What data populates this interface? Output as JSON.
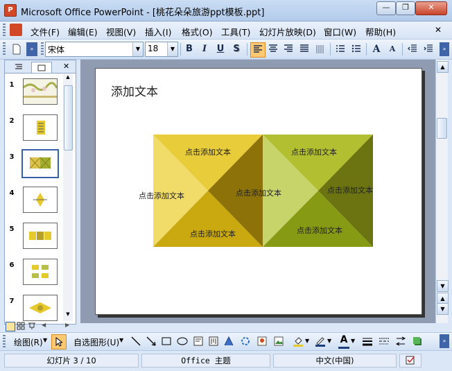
{
  "window": {
    "title": "Microsoft Office PowerPoint - [桃花朵朵旅游ppt模板.ppt]",
    "app_icon": "powerpoint-icon",
    "minimize_label": "—",
    "restore_label": "❐",
    "close_label": "✕"
  },
  "menu": {
    "items": [
      "文件(F)",
      "编辑(E)",
      "视图(V)",
      "插入(I)",
      "格式(O)",
      "工具(T)",
      "幻灯片放映(D)",
      "窗口(W)",
      "帮助(H)"
    ],
    "close_doc": "✕"
  },
  "toolbar": {
    "font_name": "宋体",
    "font_size": "18",
    "bold": "B",
    "italic": "I",
    "underline": "U",
    "shadow": "S",
    "grow_font": "A",
    "shrink_font": "A"
  },
  "left_pane": {
    "tab_outline": "outline-icon",
    "tab_slides": "slides-icon",
    "close": "✕",
    "slide_numbers": [
      "1",
      "2",
      "3",
      "4",
      "5",
      "6",
      "7"
    ],
    "selected_slide": "3"
  },
  "slide": {
    "title": "添加文本",
    "texts": {
      "left_top": "点击添加文本",
      "left_left": "点击添加文本",
      "left_bottom": "点击添加文本",
      "center": "点击添加文本",
      "right_top": "点击添加文本",
      "right_right": "点击添加文本",
      "right_bottom": "点击添加文本"
    },
    "colors": {
      "yellow_top": "#e8cc3a",
      "yellow_left": "#f1dc6a",
      "yellow_bottom": "#c9a90f",
      "yellow_right_dark": "#8c7209",
      "olive_left": "#c7d46a",
      "olive_top": "#b2bf30",
      "olive_bottom": "#879a13",
      "olive_right": "#6b7410"
    }
  },
  "drawing_toolbar": {
    "draw_label": "绘图(R)",
    "autoshapes_label": "自选图形(U)"
  },
  "status": {
    "slide_info": "幻灯片 3 / 10",
    "theme": "Office 主题",
    "language": "中文(中国)"
  }
}
